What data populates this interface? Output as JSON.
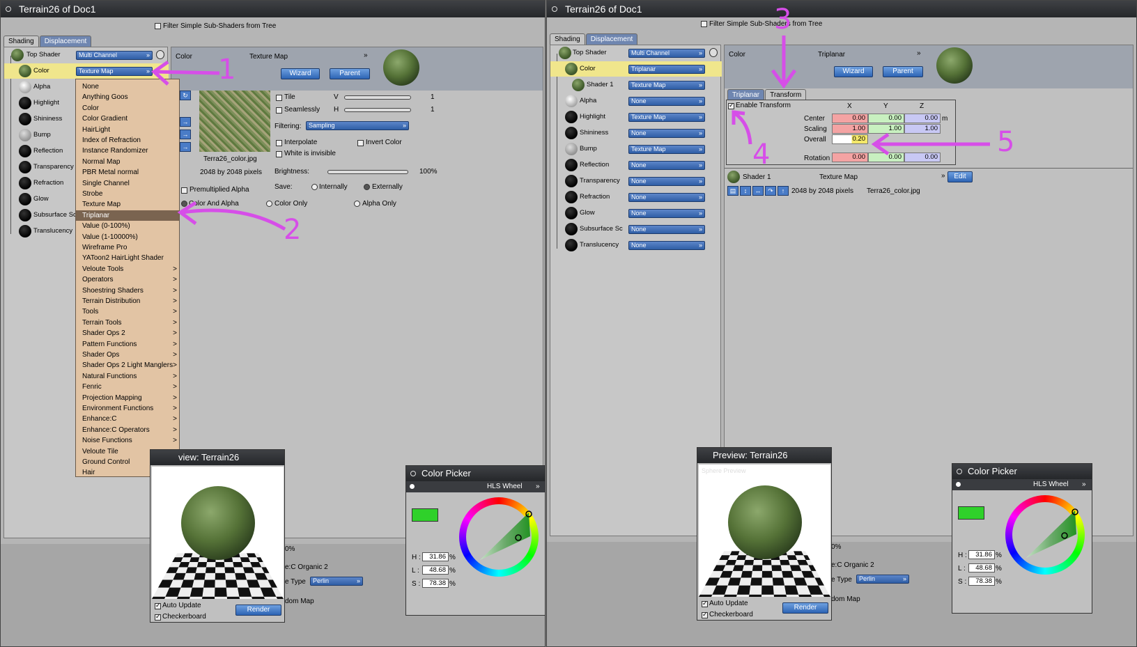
{
  "left": {
    "title": "Terrain26 of Doc1",
    "filter_label": "Filter Simple Sub-Shaders from Tree",
    "tabs": [
      "Shading",
      "Displacement"
    ],
    "tree": [
      {
        "label": "Top Shader",
        "value": "Multi Channel"
      },
      {
        "label": "Color",
        "value": "Texture Map"
      },
      {
        "label": "Alpha",
        "value": ""
      },
      {
        "label": "Highlight",
        "value": ""
      },
      {
        "label": "Shininess",
        "value": ""
      },
      {
        "label": "Bump",
        "value": ""
      },
      {
        "label": "Reflection",
        "value": ""
      },
      {
        "label": "Transparency",
        "value": ""
      },
      {
        "label": "Refraction",
        "value": ""
      },
      {
        "label": "Glow",
        "value": ""
      },
      {
        "label": "Subsurface Sc",
        "value": ""
      },
      {
        "label": "Translucency",
        "value": ""
      }
    ],
    "menu": {
      "items": [
        "None",
        "Anything Goos",
        "Color",
        "Color Gradient",
        "HairLight",
        "Index of Refraction",
        "Instance Randomizer",
        "Normal Map",
        "PBR Metal normal",
        "Single Channel",
        "Strobe",
        "Texture Map",
        "Triplanar",
        "Value (0-100%)",
        "Value (1-10000%)",
        "Wireframe Pro",
        "YAToon2 HairLight Shader",
        "Veloute Tools",
        "Operators",
        "Shoestring Shaders",
        "Terrain Distribution",
        "Tools",
        "Terrain Tools",
        "Shader Ops 2",
        "Pattern Functions",
        "Shader Ops",
        "Shader Ops 2 Light Manglers",
        "Natural Functions",
        "Fenric",
        "Projection Mapping",
        "Environment Functions",
        "Enhance:C",
        "Enhance:C Operators",
        "Noise Functions",
        "Veloute Tile",
        "Ground Control",
        "Hair"
      ],
      "submenu_start": 17,
      "highlighted": 12,
      "submenu_marker": ">"
    },
    "panel": {
      "channel": "Color",
      "type": "Texture Map",
      "wizard": "Wizard",
      "parent": "Parent",
      "filename": "Terra26_color.jpg",
      "size": "2048 by 2048 pixels",
      "tile": "Tile",
      "seamlessly": "Seamlessly",
      "v": "V",
      "h": "H",
      "v_val": "1",
      "h_val": "1",
      "filtering_label": "Filtering:",
      "filtering_value": "Sampling",
      "interpolate": "Interpolate",
      "invert": "Invert Color",
      "white_invisible": "White is invisible",
      "brightness_label": "Brightness:",
      "brightness_value": "100%",
      "premult": "Premultiplied Alpha",
      "save_label": "Save:",
      "internally": "Internally",
      "externally": "Externally",
      "color_alpha": "Color And Alpha",
      "color_only": "Color Only",
      "alpha_only": "Alpha Only"
    },
    "preview": {
      "title": "view: Terrain26",
      "auto": "Auto Update",
      "checker": "Checkerboard",
      "render": "Render"
    },
    "bottom": {
      "pct": "0%",
      "organic": "e:C Organic 2",
      "type_label": "e Type",
      "type_value": "Perlin",
      "random": "dom Map"
    }
  },
  "right": {
    "title": "Terrain26 of Doc1",
    "filter_label": "Filter Simple Sub-Shaders from Tree",
    "tabs": [
      "Shading",
      "Displacement"
    ],
    "tree": [
      {
        "label": "Top Shader",
        "value": "Multi Channel"
      },
      {
        "label": "Color",
        "value": "Triplanar"
      },
      {
        "label": "Shader 1",
        "value": "Texture Map"
      },
      {
        "label": "Alpha",
        "value": "None"
      },
      {
        "label": "Highlight",
        "value": "Texture Map"
      },
      {
        "label": "Shininess",
        "value": "None"
      },
      {
        "label": "Bump",
        "value": "Texture Map"
      },
      {
        "label": "Reflection",
        "value": "None"
      },
      {
        "label": "Transparency",
        "value": "None"
      },
      {
        "label": "Refraction",
        "value": "None"
      },
      {
        "label": "Glow",
        "value": "None"
      },
      {
        "label": "Subsurface Sc",
        "value": "None"
      },
      {
        "label": "Translucency",
        "value": "None"
      }
    ],
    "panel": {
      "channel": "Color",
      "type": "Triplanar",
      "wizard": "Wizard",
      "parent": "Parent",
      "subtabs": [
        "Triplanar",
        "Transform"
      ],
      "enable": "Enable Transform",
      "cols": [
        "X",
        "Y",
        "Z"
      ],
      "rows": [
        {
          "label": "Center",
          "x": "0.00",
          "y": "0.00",
          "z": "0.00",
          "unit": "m"
        },
        {
          "label": "Scaling",
          "x": "1.00",
          "y": "1.00",
          "z": "1.00",
          "unit": ""
        },
        {
          "label": "Overall",
          "x": "0.20",
          "y": "",
          "z": "",
          "unit": ""
        },
        {
          "label": "Rotation",
          "x": "0.00",
          "y": "0.00",
          "z": "0.00",
          "unit": ""
        }
      ],
      "shader1": "Shader 1",
      "shader1_type": "Texture Map",
      "edit": "Edit",
      "size": "2048 by 2048 pixels",
      "filename": "Terra26_color.jpg"
    },
    "preview": {
      "title": "Preview: Terrain26",
      "overlay": "Sphere Preview",
      "auto": "Auto Update",
      "checker": "Checkerboard",
      "render": "Render"
    },
    "bottom": {
      "pct": "0%",
      "organic": "e:C Organic 2",
      "type_label": "e Type",
      "type_value": "Perlin",
      "random": "dom Map"
    }
  },
  "color_picker": {
    "title": "Color Picker",
    "mode": "HLS Wheel",
    "h_label": "H :",
    "l_label": "L :",
    "s_label": "S :",
    "h": "31.86",
    "l": "48.68",
    "s": "78.38",
    "unit": "%",
    "swatch": "#2fd12a"
  },
  "annotations": [
    "1",
    "2",
    "3",
    "4",
    "5"
  ],
  "colors": {
    "annotation": "#d64ee8",
    "selection": "#f0e68c",
    "menu": "#e2c4a4"
  }
}
